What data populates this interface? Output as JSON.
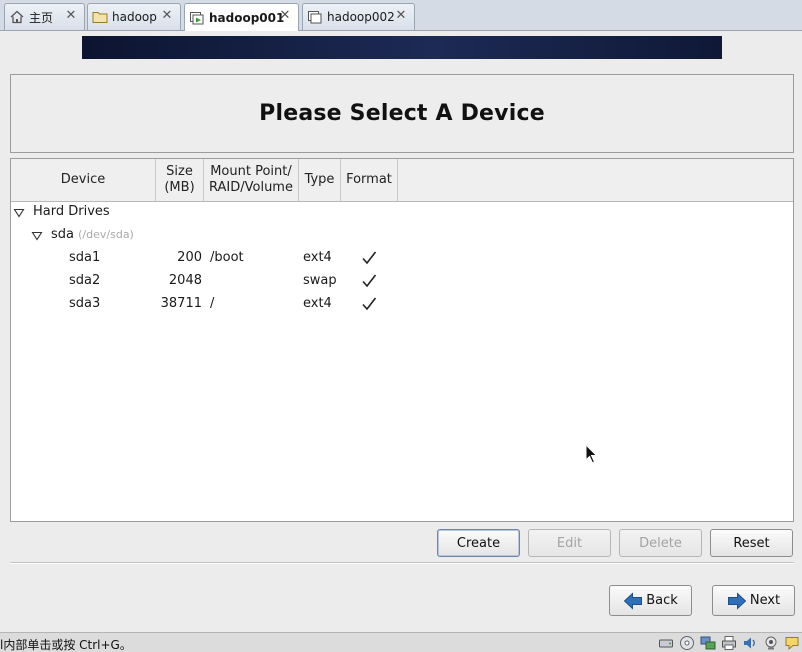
{
  "tabs": [
    {
      "label": "主页",
      "icon": "home-icon"
    },
    {
      "label": "hadoop",
      "icon": "folder-icon"
    },
    {
      "label": "hadoop001",
      "icon": "vm-running-icon",
      "active": true
    },
    {
      "label": "hadoop002",
      "icon": "vm-icon"
    }
  ],
  "installer": {
    "title": "Please Select A Device",
    "columns": {
      "device": "Device",
      "size_l1": "Size",
      "size_l2": "(MB)",
      "mount_l1": "Mount Point/",
      "mount_l2": "RAID/Volume",
      "type": "Type",
      "format": "Format"
    },
    "tree": {
      "group_label": "Hard Drives",
      "disk_label": "sda",
      "disk_path": "(/dev/sda)",
      "partitions": [
        {
          "device": "sda1",
          "size": "200",
          "mount": "/boot",
          "type": "ext4",
          "format": true
        },
        {
          "device": "sda2",
          "size": "2048",
          "mount": "",
          "type": "swap",
          "format": true
        },
        {
          "device": "sda3",
          "size": "38711",
          "mount": "/",
          "type": "ext4",
          "format": true
        }
      ]
    },
    "buttons": {
      "create": "Create",
      "edit": "Edit",
      "delete": "Delete",
      "reset": "Reset",
      "back": "Back",
      "next": "Next"
    }
  },
  "statusbar": {
    "text": "l内部单击或按 Ctrl+G。",
    "icons": [
      "hard-disk-icon",
      "cd-drive-icon",
      "network-icon",
      "printer-icon",
      "sound-icon",
      "camera-icon",
      "message-icon"
    ]
  },
  "colors": {
    "banner": "#1d2a55",
    "next_arrow": "#2f6fb8"
  }
}
